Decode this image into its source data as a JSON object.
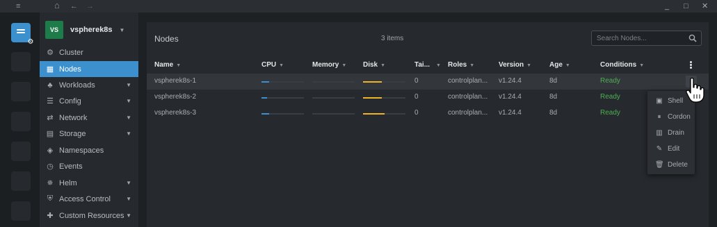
{
  "titlebar": {
    "menu_icon": "hamburger-icon",
    "home_icon": "home-icon",
    "back_icon": "arrow-left-icon",
    "forward_icon": "arrow-right-icon",
    "minimize": "_",
    "maximize": "□",
    "close": "✕"
  },
  "cluster": {
    "avatar": "VS",
    "name": "vspherek8s"
  },
  "sidebar": {
    "items": [
      {
        "label": "Cluster",
        "icon": "cluster-icon",
        "expandable": false
      },
      {
        "label": "Nodes",
        "icon": "nodes-icon",
        "expandable": false,
        "active": true
      },
      {
        "label": "Workloads",
        "icon": "workloads-icon",
        "expandable": true
      },
      {
        "label": "Config",
        "icon": "config-icon",
        "expandable": true
      },
      {
        "label": "Network",
        "icon": "network-icon",
        "expandable": true
      },
      {
        "label": "Storage",
        "icon": "storage-icon",
        "expandable": true
      },
      {
        "label": "Namespaces",
        "icon": "namespaces-icon",
        "expandable": false
      },
      {
        "label": "Events",
        "icon": "events-icon",
        "expandable": false
      },
      {
        "label": "Helm",
        "icon": "helm-icon",
        "expandable": true
      },
      {
        "label": "Access Control",
        "icon": "access-control-icon",
        "expandable": true
      },
      {
        "label": "Custom Resources",
        "icon": "custom-resources-icon",
        "expandable": true
      }
    ]
  },
  "main": {
    "title": "Nodes",
    "item_count": "3 items",
    "search_placeholder": "Search Nodes...",
    "columns": [
      "Name",
      "CPU",
      "Memory",
      "Disk",
      "Tai...",
      "Roles",
      "Version",
      "Age",
      "Conditions"
    ],
    "rows": [
      {
        "name": "vspherek8s-1",
        "cpu": 0.18,
        "memory": 0.0,
        "disk": 0.45,
        "taints": "0",
        "roles": "controlplan...",
        "version": "v1.24.4",
        "age": "8d",
        "conditions": "Ready"
      },
      {
        "name": "vspherek8s-2",
        "cpu": 0.13,
        "memory": 0.0,
        "disk": 0.45,
        "taints": "0",
        "roles": "controlplan...",
        "version": "v1.24.4",
        "age": "8d",
        "conditions": "Ready"
      },
      {
        "name": "vspherek8s-3",
        "cpu": 0.18,
        "memory": 0.0,
        "disk": 0.5,
        "taints": "0",
        "roles": "controlplan...",
        "version": "v1.24.4",
        "age": "8d",
        "conditions": "Ready"
      }
    ]
  },
  "context_menu": {
    "items": [
      {
        "label": "Shell",
        "icon": "terminal-icon"
      },
      {
        "label": "Cordon",
        "icon": "pause-circle-icon"
      },
      {
        "label": "Drain",
        "icon": "drain-icon"
      },
      {
        "label": "Edit",
        "icon": "pencil-icon"
      },
      {
        "label": "Delete",
        "icon": "trash-icon"
      }
    ]
  },
  "colors": {
    "accent": "#3d90ce",
    "cpu_bar": "#3d90ce",
    "disk_bar": "#f0b429",
    "ready": "#4caf50",
    "cluster_avatar": "#1e7b4a"
  }
}
